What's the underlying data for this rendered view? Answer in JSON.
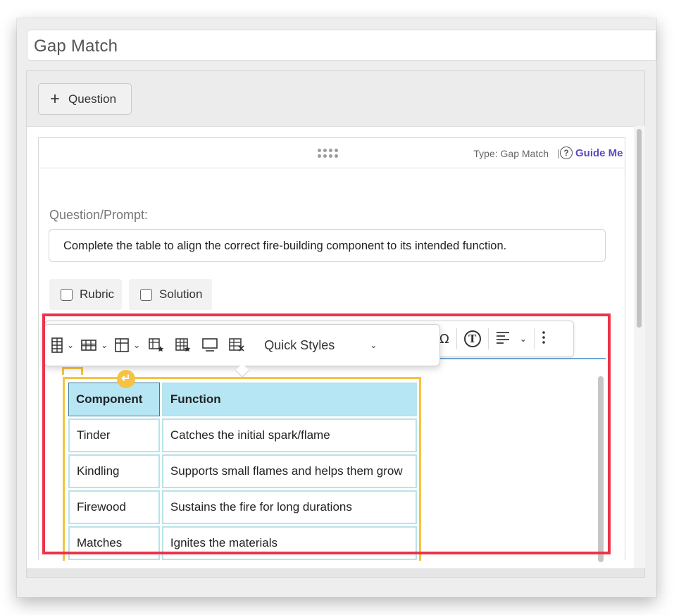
{
  "window": {
    "title_value": "Gap Match"
  },
  "panel": {
    "add_question_label": "Question"
  },
  "card": {
    "type_label": "Type: Gap Match",
    "separator": "|",
    "guide_icon": "?",
    "guide_label": "Guide Me",
    "prompt_label": "Question/Prompt:",
    "prompt_text": "Complete the table to align the correct fire-building component to its intended function.",
    "rubric_label": "Rubric",
    "solution_label": "Solution"
  },
  "toolbar": {
    "quick_styles_label": "Quick Styles",
    "special_char_glyph": "Ω",
    "text_style_glyph": "T",
    "icons": [
      "table-icon",
      "table-row-icon",
      "table-column-icon",
      "table-cell-style-icon",
      "table-style-icon",
      "table-caption-icon",
      "table-delete-icon",
      "special-char-icon",
      "text-style-icon",
      "align-left-icon",
      "more-icon"
    ]
  },
  "table": {
    "headers": [
      "Component",
      "Function"
    ],
    "rows": [
      [
        "Tinder",
        "Catches the initial spark/flame"
      ],
      [
        "Kindling",
        "Supports small flames and helps them grow"
      ],
      [
        "Firewood",
        "Sustains the fire for long durations"
      ],
      [
        "Matches",
        "Ignites the materials"
      ]
    ]
  },
  "colors": {
    "accent_purple": "#5b4bbd",
    "table_header_bg": "#b6e6f4",
    "table_border": "#b7e3ea",
    "selection_yellow": "#f6c242",
    "focus_red": "#ee3247",
    "editor_blue": "#6fa8dc"
  }
}
